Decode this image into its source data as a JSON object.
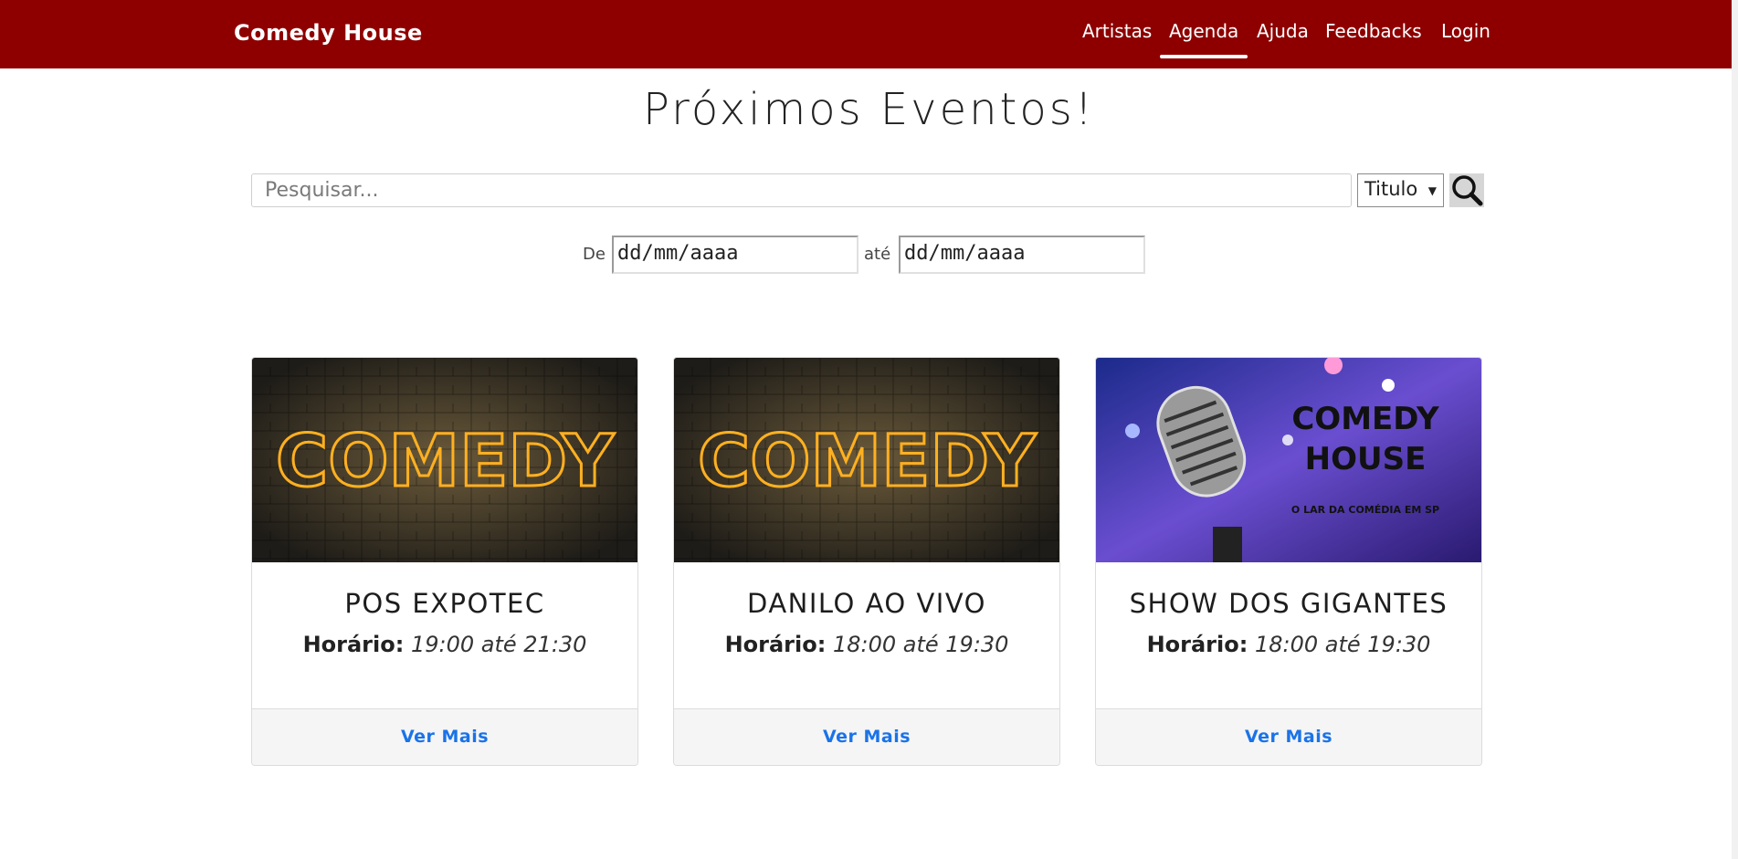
{
  "navbar": {
    "brand": "Comedy House",
    "items": [
      {
        "label": "Artistas",
        "active": false
      },
      {
        "label": "Agenda",
        "active": true
      },
      {
        "label": "Ajuda",
        "active": false
      },
      {
        "label": "Feedbacks",
        "active": false
      },
      {
        "label": "Login",
        "active": false
      }
    ]
  },
  "page_title": "Próximos Eventos!",
  "search": {
    "placeholder": "Pesquisar...",
    "filter_selected": "Titulo",
    "search_icon": "magnifier-icon"
  },
  "date_filter": {
    "from_label": "De",
    "from_placeholder": "dd/mm/aaaa",
    "to_label": "até",
    "to_placeholder": "dd/mm/aaaa"
  },
  "colors": {
    "navbar_bg": "#8e0000",
    "link": "#1a73e8"
  },
  "events": [
    {
      "image_text": "COMEDY",
      "title": "POS EXPOTEC",
      "time_label": "Horário:",
      "time_value": "19:00 até 21:30",
      "action": "Ver Mais"
    },
    {
      "image_text": "COMEDY",
      "title": "DANILO AO VIVO",
      "time_label": "Horário:",
      "time_value": "18:00 até 19:30",
      "action": "Ver Mais"
    },
    {
      "image_text_line1": "COMEDY",
      "image_text_line2": "HOUSE",
      "image_tagline": "O LAR DA COMÉDIA EM SP",
      "title": "SHOW DOS GIGANTES",
      "time_label": "Horário:",
      "time_value": "18:00 até 19:30",
      "action": "Ver Mais"
    }
  ]
}
